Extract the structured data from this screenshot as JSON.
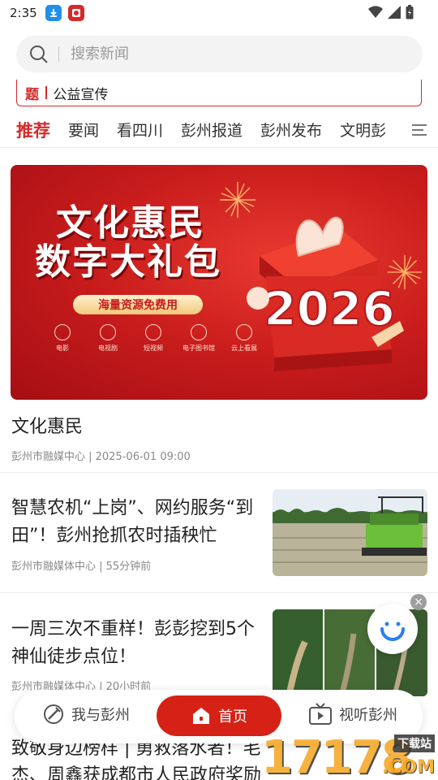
{
  "status_bar": {
    "time": "2:35"
  },
  "search": {
    "placeholder": "搜索新闻"
  },
  "ticker": {
    "tag": "题",
    "text": "公益宣传"
  },
  "tabs": [
    {
      "label": "推荐",
      "active": true
    },
    {
      "label": "要闻"
    },
    {
      "label": "看四川"
    },
    {
      "label": "彭州报道"
    },
    {
      "label": "彭州发布"
    },
    {
      "label": "文明彭"
    }
  ],
  "banner": {
    "title_line1": "文化惠民",
    "title_line2": "数字大礼包",
    "pill": "海量资源免费用",
    "year": "2026",
    "icons": [
      {
        "label": "电影",
        "icon": "film-icon"
      },
      {
        "label": "电视剧",
        "icon": "tv-icon"
      },
      {
        "label": "短视频",
        "icon": "play-icon"
      },
      {
        "label": "电子图书馆",
        "icon": "book-icon"
      },
      {
        "label": "云上看展",
        "icon": "exhibit-icon"
      }
    ]
  },
  "featured": {
    "title": "文化惠民",
    "meta": "彭州市融媒中心 | 2025-06-01 09:00"
  },
  "news": [
    {
      "title": "智慧农机“上岗”、网约服务“到田”！彭州抢抓农时插秧忙",
      "meta": "彭州市融媒体中心 | 55分钟前"
    },
    {
      "title": "一周三次不重样！彭彭挖到5个神仙徒步点位！",
      "meta": "彭州市融媒体中心 | 20小时前"
    }
  ],
  "next_article": {
    "title": "致敬身边榜样 | 勇救落水者！毛杰、周鑫获成都市人民政府奖励"
  },
  "bottom_nav": {
    "left": "我与彭州",
    "home": "首页",
    "right": "视听彭州"
  },
  "watermark": {
    "text": "17178",
    "sub": "下载站",
    "suffix": ".COM"
  },
  "colors": {
    "accent": "#d42a2a",
    "home_button": "#d62216"
  }
}
